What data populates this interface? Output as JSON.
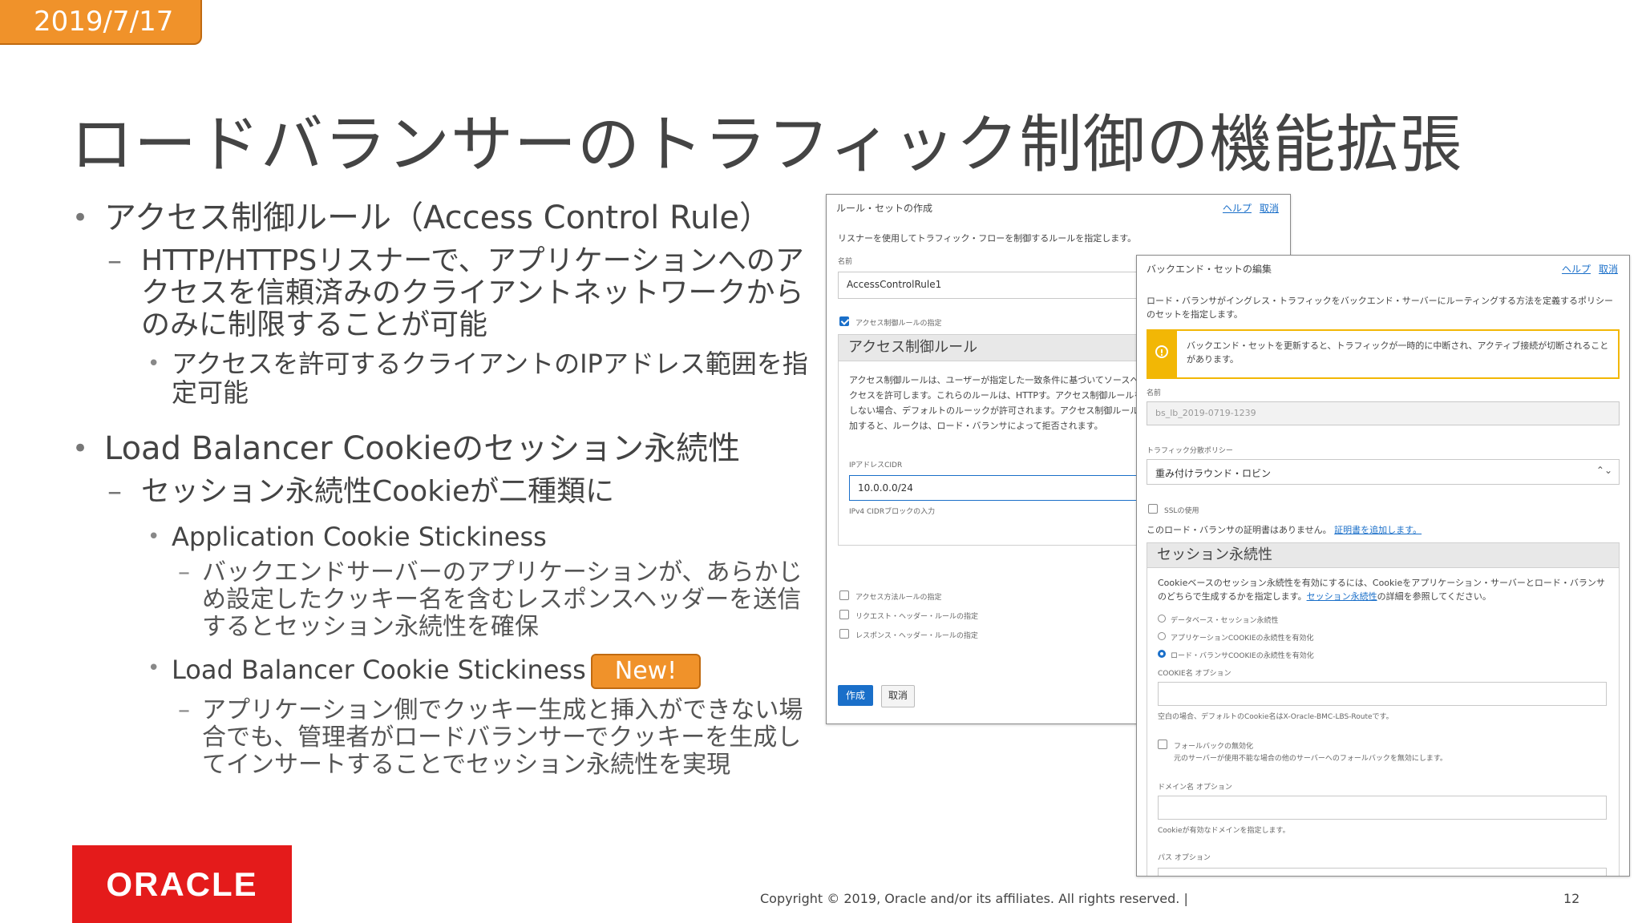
{
  "date": "2019/7/17",
  "title": "ロードバランサーのトラフィック制御の機能拡張",
  "bullets": {
    "acr": "アクセス制御ルール（Access Control Rule）",
    "acr_sub": "HTTP/HTTPSリスナーで、アプリケーションへのアクセスを信頼済みのクライアントネットワークからのみに制限することが可能",
    "acr_sub2": "アクセスを許可するクライアントのIPアドレス範囲を指定可能",
    "lbc": "Load Balancer Cookieのセッション永続性",
    "lbc_sub": "セッション永続性Cookieが二種類に",
    "app_cookie": "Application Cookie Stickiness",
    "app_cookie_desc": "バックエンドサーバーのアプリケーションが、あらかじめ設定したクッキー名を含むレスポンスヘッダーを送信するとセッション永続性を確保",
    "lb_cookie": "Load Balancer Cookie Stickiness",
    "new_badge": "New!",
    "lb_cookie_desc": "アプリケーション側でクッキー生成と挿入ができない場合でも、管理者がロードバランサーでクッキーを生成してインサートすることでセッション永続性を実現"
  },
  "dialog1": {
    "title": "ルール・セットの作成",
    "help": "ヘルプ",
    "cancel_link": "取消",
    "desc": "リスナーを使用してトラフィック・フローを制御するルールを指定します。",
    "name_label": "名前",
    "name_value": "AccessControlRule1",
    "cb_acr": "アクセス制御ルールの指定",
    "section": "アクセス制御ルール",
    "section_desc": "アクセス制御ルールは、ユーザーが指定した一致条件に基づいてソースへのアクセスを許可します。これらのルールは、HTTPす。アクセス制御ルールを指定しない場合、デフォルトのルーックが許可されます。アクセス制御ルールを追加すると、ルークは、ロード・バランサによって拒否されます。",
    "cidr_label": "IPアドレスCIDR",
    "cidr_value": "10.0.0.0/24",
    "cidr_hint": "IPv4 CIDRブロックの入力",
    "cb_method": "アクセス方法ルールの指定",
    "cb_req": "リクエスト・ヘッダー・ルールの指定",
    "cb_res": "レスポンス・ヘッダー・ルールの指定",
    "create_btn": "作成",
    "cancel_btn": "取消"
  },
  "dialog2": {
    "title": "バックエンド・セットの編集",
    "help": "ヘルプ",
    "cancel_link": "取消",
    "desc": "ロード・バランサがイングレス・トラフィックをバックエンド・サーバーにルーティングする方法を定義するポリシーのセットを指定します。",
    "warning": "バックエンド・セットを更新すると、トラフィックが一時的に中断され、アクティブ接続が切断されることがあります。",
    "name_label": "名前",
    "name_value": "bs_lb_2019-0719-1239",
    "policy_label": "トラフィック分散ポリシー",
    "policy_value": "重み付けラウンド・ロビン",
    "ssl_label": "SSLの使用",
    "cert_text": "このロード・バランサの証明書はありません。",
    "cert_link": "証明書を追加します。",
    "section": "セッション永続性",
    "section_desc_1": "Cookieベースのセッション永続性を有効にするには、Cookieをアプリケーション・サーバーとロード・バランサのどちらで生成するかを指定します。",
    "section_desc_link": "セッション永続性",
    "section_desc_2": "の詳細を参照してください。",
    "radio_1": "データベース・セッション永続性",
    "radio_2": "アプリケーションCOOKIEの永続性を有効化",
    "radio_3": "ロード・バランサCOOKIEの永続性を有効化",
    "cookie_label": "COOKIE名  オプション",
    "cookie_hint": "空白の場合、デフォルトのCookie名はX-Oracle-BMC-LBS-Routeです。",
    "fallback_label": "フォールバックの無効化",
    "fallback_hint": "元のサーバーが使用不能な場合の他のサーバーへのフォールバックを無効にします。",
    "domain_label": "ドメイン名  オプション",
    "domain_hint": "Cookieが有効なドメインを指定します。",
    "path_label": "パス  オプション"
  },
  "footer": {
    "copyright": "Copyright © 2019, Oracle and/or its affiliates. All rights reserved.  |",
    "page": "12"
  },
  "logo": "ORACLE",
  "colors": {
    "accent_orange": "#f0922a",
    "oracle_red": "#e41b1b",
    "link_blue": "#1a6fc9",
    "warning_yellow": "#f2b705"
  }
}
